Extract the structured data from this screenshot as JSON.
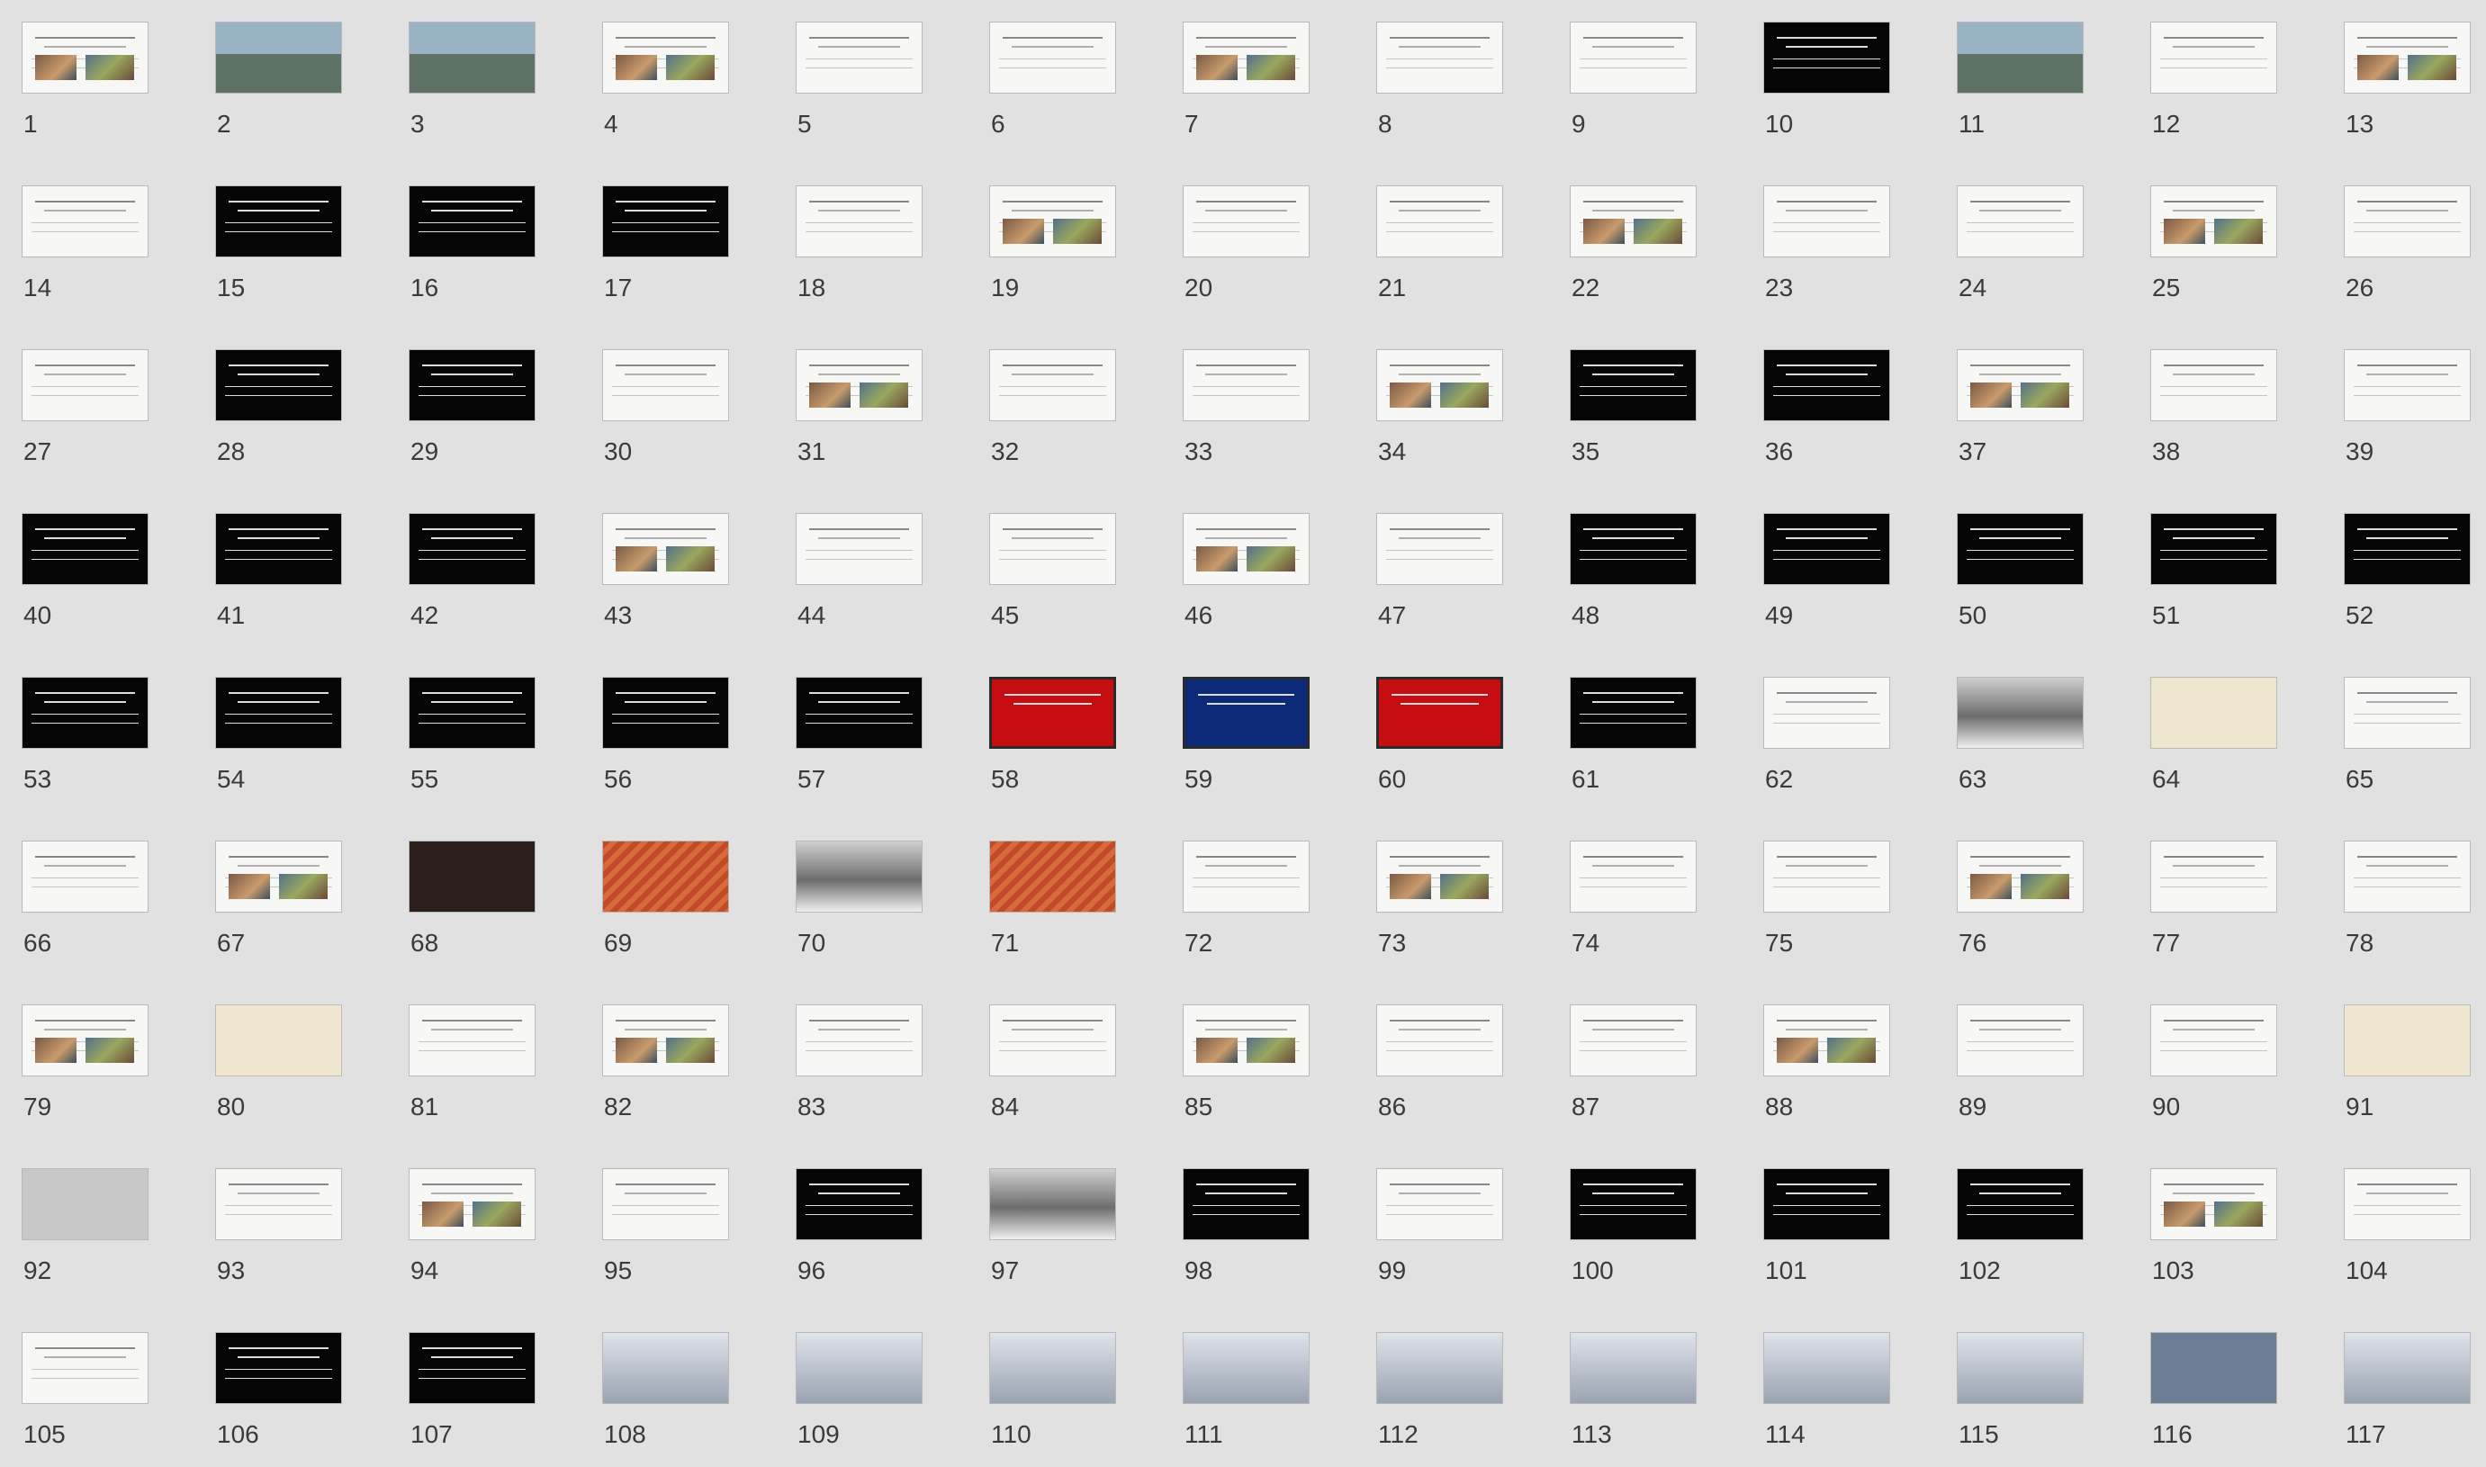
{
  "slides": [
    {
      "num": "1",
      "style": "white"
    },
    {
      "num": "2",
      "style": "photo"
    },
    {
      "num": "3",
      "style": "photo"
    },
    {
      "num": "4",
      "style": "white"
    },
    {
      "num": "5",
      "style": "white"
    },
    {
      "num": "6",
      "style": "white"
    },
    {
      "num": "7",
      "style": "white"
    },
    {
      "num": "8",
      "style": "white"
    },
    {
      "num": "9",
      "style": "white"
    },
    {
      "num": "10",
      "style": "black"
    },
    {
      "num": "11",
      "style": "photo"
    },
    {
      "num": "12",
      "style": "white"
    },
    {
      "num": "13",
      "style": "white"
    },
    {
      "num": "14",
      "style": "white"
    },
    {
      "num": "15",
      "style": "black"
    },
    {
      "num": "16",
      "style": "black"
    },
    {
      "num": "17",
      "style": "black"
    },
    {
      "num": "18",
      "style": "white"
    },
    {
      "num": "19",
      "style": "white"
    },
    {
      "num": "20",
      "style": "white"
    },
    {
      "num": "21",
      "style": "white"
    },
    {
      "num": "22",
      "style": "white"
    },
    {
      "num": "23",
      "style": "white"
    },
    {
      "num": "24",
      "style": "white"
    },
    {
      "num": "25",
      "style": "white"
    },
    {
      "num": "26",
      "style": "white"
    },
    {
      "num": "27",
      "style": "white"
    },
    {
      "num": "28",
      "style": "black"
    },
    {
      "num": "29",
      "style": "black"
    },
    {
      "num": "30",
      "style": "white"
    },
    {
      "num": "31",
      "style": "white"
    },
    {
      "num": "32",
      "style": "white"
    },
    {
      "num": "33",
      "style": "white"
    },
    {
      "num": "34",
      "style": "white"
    },
    {
      "num": "35",
      "style": "black"
    },
    {
      "num": "36",
      "style": "black"
    },
    {
      "num": "37",
      "style": "white"
    },
    {
      "num": "38",
      "style": "white"
    },
    {
      "num": "39",
      "style": "white"
    },
    {
      "num": "40",
      "style": "black"
    },
    {
      "num": "41",
      "style": "black"
    },
    {
      "num": "42",
      "style": "black"
    },
    {
      "num": "43",
      "style": "white"
    },
    {
      "num": "44",
      "style": "white"
    },
    {
      "num": "45",
      "style": "white"
    },
    {
      "num": "46",
      "style": "white"
    },
    {
      "num": "47",
      "style": "white"
    },
    {
      "num": "48",
      "style": "black"
    },
    {
      "num": "49",
      "style": "black"
    },
    {
      "num": "50",
      "style": "black"
    },
    {
      "num": "51",
      "style": "black"
    },
    {
      "num": "52",
      "style": "black"
    },
    {
      "num": "53",
      "style": "black"
    },
    {
      "num": "54",
      "style": "black"
    },
    {
      "num": "55",
      "style": "black"
    },
    {
      "num": "56",
      "style": "black"
    },
    {
      "num": "57",
      "style": "black"
    },
    {
      "num": "58",
      "style": "red"
    },
    {
      "num": "59",
      "style": "navy"
    },
    {
      "num": "60",
      "style": "red"
    },
    {
      "num": "61",
      "style": "black"
    },
    {
      "num": "62",
      "style": "white"
    },
    {
      "num": "63",
      "style": "ink"
    },
    {
      "num": "64",
      "style": "beige"
    },
    {
      "num": "65",
      "style": "white"
    },
    {
      "num": "66",
      "style": "white"
    },
    {
      "num": "67",
      "style": "white"
    },
    {
      "num": "68",
      "style": "dark"
    },
    {
      "num": "69",
      "style": "pattern"
    },
    {
      "num": "70",
      "style": "ink"
    },
    {
      "num": "71",
      "style": "pattern"
    },
    {
      "num": "72",
      "style": "white"
    },
    {
      "num": "73",
      "style": "white"
    },
    {
      "num": "74",
      "style": "white"
    },
    {
      "num": "75",
      "style": "white"
    },
    {
      "num": "76",
      "style": "white"
    },
    {
      "num": "77",
      "style": "white"
    },
    {
      "num": "78",
      "style": "white"
    },
    {
      "num": "79",
      "style": "white"
    },
    {
      "num": "80",
      "style": "beige"
    },
    {
      "num": "81",
      "style": "white"
    },
    {
      "num": "82",
      "style": "white"
    },
    {
      "num": "83",
      "style": "white"
    },
    {
      "num": "84",
      "style": "white"
    },
    {
      "num": "85",
      "style": "white"
    },
    {
      "num": "86",
      "style": "white"
    },
    {
      "num": "87",
      "style": "white"
    },
    {
      "num": "88",
      "style": "white"
    },
    {
      "num": "89",
      "style": "white"
    },
    {
      "num": "90",
      "style": "white"
    },
    {
      "num": "91",
      "style": "beige"
    },
    {
      "num": "92",
      "style": "gray"
    },
    {
      "num": "93",
      "style": "white"
    },
    {
      "num": "94",
      "style": "white"
    },
    {
      "num": "95",
      "style": "white"
    },
    {
      "num": "96",
      "style": "black"
    },
    {
      "num": "97",
      "style": "ink"
    },
    {
      "num": "98",
      "style": "black"
    },
    {
      "num": "99",
      "style": "white"
    },
    {
      "num": "100",
      "style": "black"
    },
    {
      "num": "101",
      "style": "black"
    },
    {
      "num": "102",
      "style": "black"
    },
    {
      "num": "103",
      "style": "white"
    },
    {
      "num": "104",
      "style": "white"
    },
    {
      "num": "105",
      "style": "white"
    },
    {
      "num": "106",
      "style": "black"
    },
    {
      "num": "107",
      "style": "black"
    },
    {
      "num": "108",
      "style": "mist"
    },
    {
      "num": "109",
      "style": "mist"
    },
    {
      "num": "110",
      "style": "mist"
    },
    {
      "num": "111",
      "style": "mist"
    },
    {
      "num": "112",
      "style": "mist"
    },
    {
      "num": "113",
      "style": "mist"
    },
    {
      "num": "114",
      "style": "mist"
    },
    {
      "num": "115",
      "style": "mist"
    },
    {
      "num": "116",
      "style": "blue"
    },
    {
      "num": "117",
      "style": "mist"
    }
  ]
}
